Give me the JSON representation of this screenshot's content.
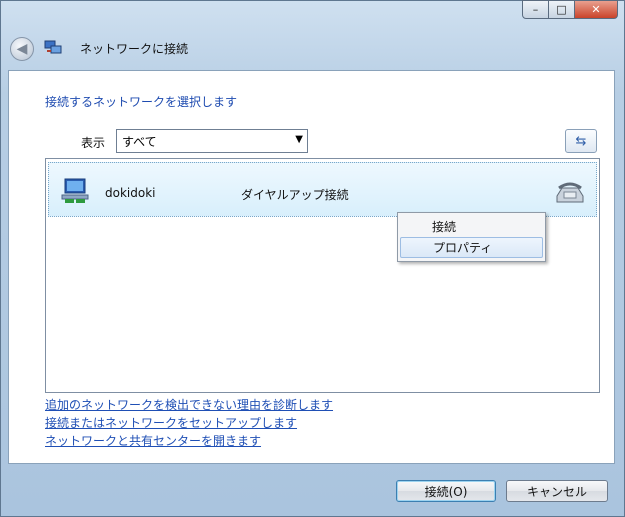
{
  "window": {
    "title": "ネットワークに接続"
  },
  "titlebar_buttons": {
    "minimize": "–",
    "maximize": "□",
    "close": "✕"
  },
  "main": {
    "heading": "接続するネットワークを選択します",
    "show_label": "表示",
    "show_value": "すべて",
    "networks": [
      {
        "name": "dokidoki",
        "type": "ダイヤルアップ接続",
        "icon": "network-computer-icon",
        "status_icon": "phone-icon"
      }
    ]
  },
  "context_menu": {
    "items": [
      "接続",
      "プロパティ"
    ]
  },
  "links": [
    "追加のネットワークを検出できない理由を診断します",
    "接続またはネットワークをセットアップします",
    "ネットワークと共有センターを開きます"
  ],
  "buttons": {
    "connect": "接続(O)",
    "cancel": "キャンセル"
  },
  "colors": {
    "accent": "#1f4fb5",
    "selection": "#d8effc"
  }
}
